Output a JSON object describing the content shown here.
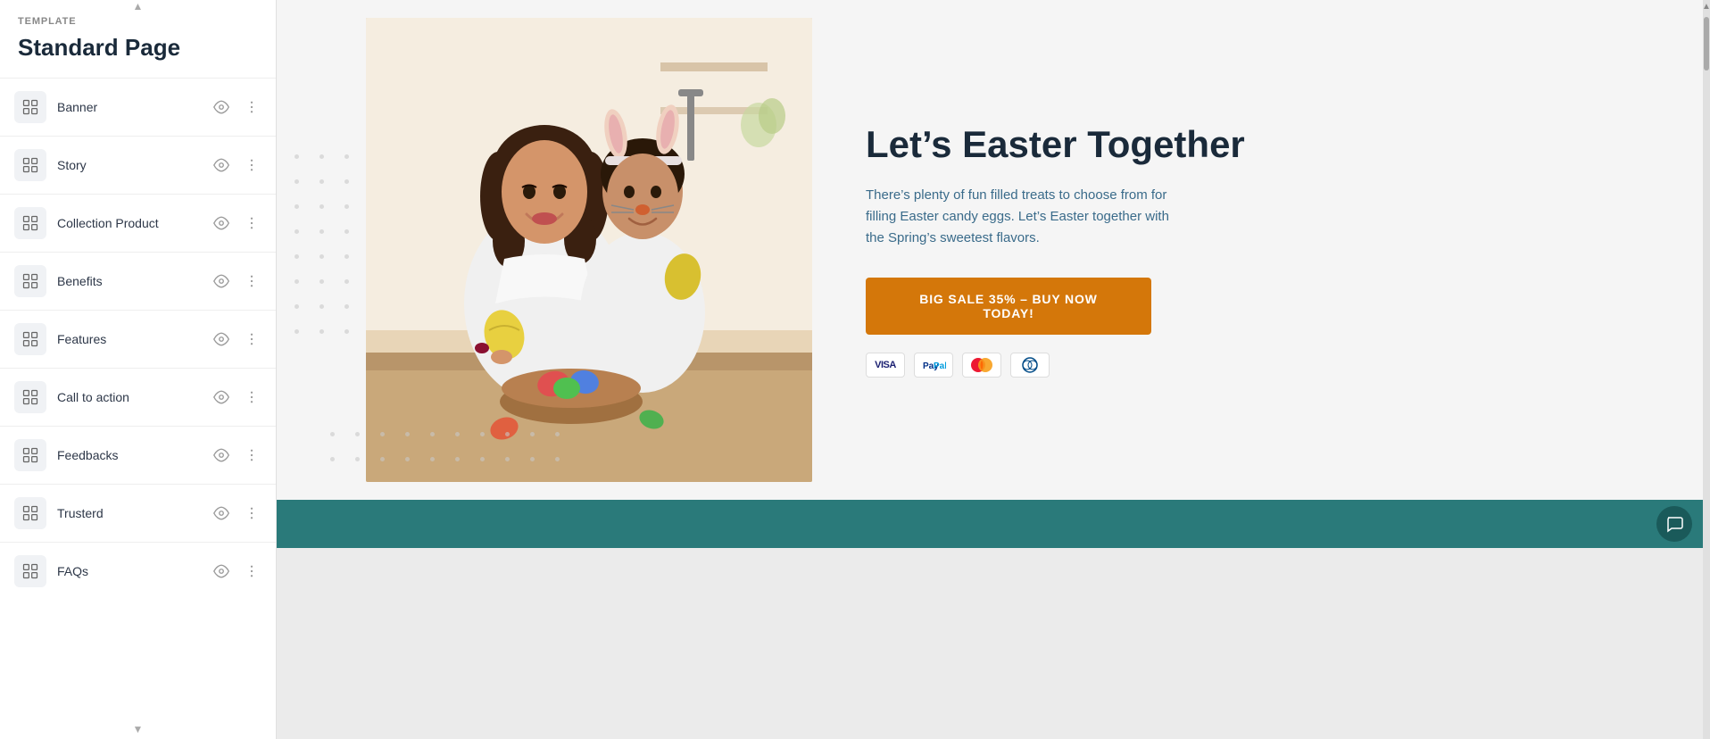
{
  "sidebar": {
    "template_label": "TEMPLATE",
    "title": "Standard Page",
    "items": [
      {
        "id": "banner",
        "label": "Banner"
      },
      {
        "id": "story",
        "label": "Story"
      },
      {
        "id": "collection-product",
        "label": "Collection Product"
      },
      {
        "id": "benefits",
        "label": "Benefits"
      },
      {
        "id": "features",
        "label": "Features"
      },
      {
        "id": "call-to-action",
        "label": "Call to action"
      },
      {
        "id": "feedbacks",
        "label": "Feedbacks"
      },
      {
        "id": "trusterd",
        "label": "Trusterd"
      },
      {
        "id": "faqs",
        "label": "FAQs"
      }
    ]
  },
  "hero": {
    "title": "Let’s Easter Together",
    "subtitle": "There’s plenty of fun filled treats to choose from for filling Easter candy eggs. Let’s Easter together with the Spring’s sweetest flavors.",
    "cta_label": "BIG SALE 35% – BUY NOW TODAY!",
    "payment_methods": [
      "VISA",
      "PayPal",
      "MC",
      "DC"
    ]
  },
  "colors": {
    "cta_bg": "#d4770a",
    "bottom_bar": "#2a7a7a",
    "hero_title": "#1a2a3a",
    "hero_subtitle": "#3a6b8a"
  }
}
